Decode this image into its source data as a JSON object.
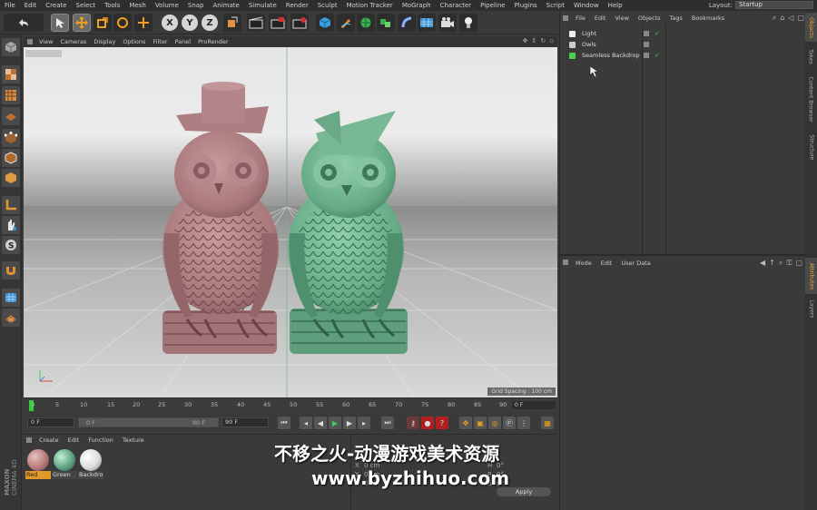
{
  "menubar": {
    "items": [
      "File",
      "Edit",
      "Create",
      "Select",
      "Tools",
      "Mesh",
      "Volume",
      "Snap",
      "Animate",
      "Simulate",
      "Render",
      "Sculpt",
      "Motion Tracker",
      "MoGraph",
      "Character",
      "Pipeline",
      "Plugins",
      "Script",
      "Window",
      "Help"
    ],
    "layout_label": "Layout:",
    "layout_value": "Startup"
  },
  "toolbar": {
    "axis_x": "X",
    "axis_y": "Y",
    "axis_z": "Z"
  },
  "viewport": {
    "menu": [
      "View",
      "Cameras",
      "Display",
      "Options",
      "Filter",
      "Panel",
      "ProRender"
    ],
    "grid_spacing": "Grid Spacing : 100 cm"
  },
  "timeline": {
    "ticks": [
      "0",
      "5",
      "10",
      "15",
      "20",
      "25",
      "30",
      "35",
      "40",
      "45",
      "50",
      "55",
      "60",
      "65",
      "70",
      "75",
      "80",
      "85",
      "90"
    ],
    "end_field": "0 F"
  },
  "transport": {
    "current_frame": "0 F",
    "range_start": "0 F",
    "range_end": "90 F",
    "max_frame": "90 F"
  },
  "material_manager": {
    "menu": [
      "Create",
      "Edit",
      "Function",
      "Texture"
    ],
    "materials": [
      {
        "name": "Red",
        "color": "#b87a7a"
      },
      {
        "name": "Green",
        "color": "#5fa382"
      },
      {
        "name": "Backdro",
        "color": "#dcdcdc"
      }
    ]
  },
  "coordinates": {
    "labels": [
      "X",
      "Y",
      "Z",
      "0 cm",
      "0 cm",
      "0 cm",
      "H",
      "P",
      "B",
      "0°",
      "0°",
      "0°"
    ],
    "apply_label": "Apply"
  },
  "object_manager": {
    "menu": [
      "File",
      "Edit",
      "View",
      "Objects",
      "Tags",
      "Bookmarks"
    ],
    "objects": [
      {
        "name": "Light",
        "icon_color": "#eeeeee"
      },
      {
        "name": "Owls",
        "icon_color": "#dddddd"
      },
      {
        "name": "Seamless Backdrop",
        "icon_color": "#4ad34a"
      }
    ]
  },
  "attribute_manager": {
    "menu": [
      "Mode",
      "Edit",
      "User Data"
    ]
  },
  "side_tabs": [
    "Objects",
    "Takes",
    "Content Browser",
    "Structure",
    "Attributes",
    "Layers"
  ],
  "watermark": {
    "line1": "不移之火-动漫游戏美术资源",
    "line2": "www.byzhihuo.com"
  },
  "colors": {
    "accent": "#e09a2a",
    "owl_left": "#b07f82",
    "owl_right": "#6cae8a",
    "timeline_marker": "#2fd03a"
  }
}
